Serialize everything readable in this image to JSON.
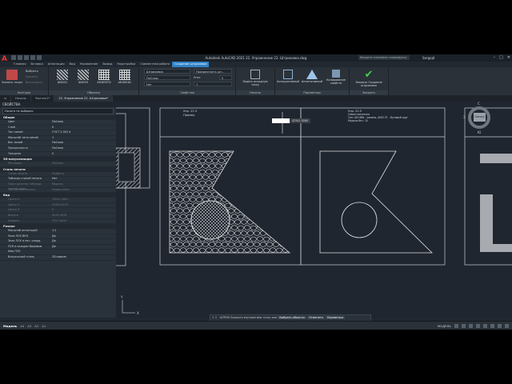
{
  "window": {
    "title": "Autodesk AutoCAD 2021  22. Упражнение 22. Штриховка.dwg",
    "search_placeholder": "Введите ключевое слово/фразу",
    "user": "Sergejd"
  },
  "ribbon_tabs": [
    "Главная",
    "Вставка",
    "Аннотации",
    "Вид",
    "Управление",
    "Вывод",
    "Надстройки",
    "Совместная работа",
    "Создание штриховки"
  ],
  "ribbon_active_tab": "Создание штриховки",
  "ribbon": {
    "pick_points": "Указать точки",
    "select": "Выбрать",
    "remove": "Удалить",
    "recreate": "Воссоздать",
    "contours_label": "Контуры",
    "patterns": [
      "ANSI31",
      "ANSI33",
      "AR-BRSTD",
      "AR-B816C"
    ],
    "pattern_label": "Образец",
    "hatch_type": "Штриховка",
    "color_value": "ПоСлою",
    "bg_value": "Нет",
    "transparency_label": "Прозрачность шт...",
    "angle_label": "Угол",
    "angle_value": "0",
    "scale_value": "1",
    "props_label": "Свойства",
    "set_origin": "Задать исходную точку",
    "origin_label": "Начало",
    "associative": "Ассоциативный",
    "annotative": "Аннотативный",
    "match": "Копирование свойств",
    "options_label": "Параметры",
    "close": "Закрыть Создание штриховки",
    "close_label": "Закрыть"
  },
  "doc_tabs": [
    "Начало",
    "Чертеж1*",
    "22. Упражнение 22. Штриховка*"
  ],
  "doc_active": "22. Упражнение 22. Штриховка*",
  "properties": {
    "title": "СВОЙСТВА",
    "selection": "Ничего не выбрано",
    "sections": [
      {
        "name": "Общие",
        "rows": [
          {
            "k": "Цвет",
            "v": "ПоСлою"
          },
          {
            "k": "Слой",
            "v": "0"
          },
          {
            "k": "Тип линий",
            "v": "ГОСТ 2.303 4"
          },
          {
            "k": "Масштаб типа линий",
            "v": "1"
          },
          {
            "k": "Вес линий",
            "v": "ПоСлою"
          },
          {
            "k": "Прозрачность",
            "v": "ПоСлою"
          },
          {
            "k": "Толщина",
            "v": "0"
          }
        ]
      },
      {
        "name": "3D-визуализация",
        "rows": [
          {
            "k": "Материал",
            "v": "ПоСлою",
            "dim": true
          }
        ]
      },
      {
        "name": "Стиль печати",
        "rows": [
          {
            "k": "Стиль печати",
            "v": "ПоЦвету",
            "dim": true
          },
          {
            "k": "Таблица стилей печати",
            "v": "Нет"
          },
          {
            "k": "Пространство таблицы стилей печа...",
            "v": "Модель",
            "dim": true
          },
          {
            "k": "Тип стилей печати",
            "v": "Недоступно",
            "dim": true
          }
        ]
      },
      {
        "name": "Вид",
        "rows": [
          {
            "k": "Центр X",
            "v": "13921.1601",
            "dim": true
          },
          {
            "k": "Центр Y",
            "v": "41329.2575",
            "dim": true
          },
          {
            "k": "Центр Z",
            "v": "0",
            "dim": true
          },
          {
            "k": "Высота",
            "v": "4530.2678",
            "dim": true
          },
          {
            "k": "Ширина",
            "v": "7927.8419",
            "dim": true
          }
        ]
      },
      {
        "name": "Разное",
        "rows": [
          {
            "k": "Масштаб аннотаций",
            "v": "1:1"
          },
          {
            "k": "Знак ПСК ВКЛ",
            "v": "Да"
          },
          {
            "k": "Знак ПСК в нач. коорд.",
            "v": "Да"
          },
          {
            "k": "ПСК в каждом Видовом",
            "v": "Да"
          },
          {
            "k": "Имя ПСК",
            "v": ""
          },
          {
            "k": "Визуальный стиль",
            "v": "2D-каркас"
          }
        ]
      }
    ]
  },
  "canvas": {
    "sheet1_title": "Упр. 22.5",
    "sheet1_sub": "Пример",
    "sheet2_title": "Упр. 22.5",
    "sheet2_line1": "Самостоятельно",
    "sheet2_line2": "Тип: AR-HBN – камень, ANSI 37 – бутовый круг",
    "sheet2_line3": "Модель бет. 10",
    "tooltip_value": "42341.5000",
    "viewcube_top": "С",
    "viewcube_face": "Сверху",
    "viewcube_bottom": "Ю",
    "viewcube_west": "З"
  },
  "command": {
    "prompt": "ШТРИХ Укажите внутреннюю точку или",
    "options": [
      "Выбрать объекты",
      "Отменить",
      "Параметры"
    ]
  },
  "status": {
    "layouts": [
      "Модель",
      "A4",
      "A3",
      "A2",
      "A1"
    ],
    "active": "Модель",
    "model_label": "МОДЕЛЬ"
  }
}
